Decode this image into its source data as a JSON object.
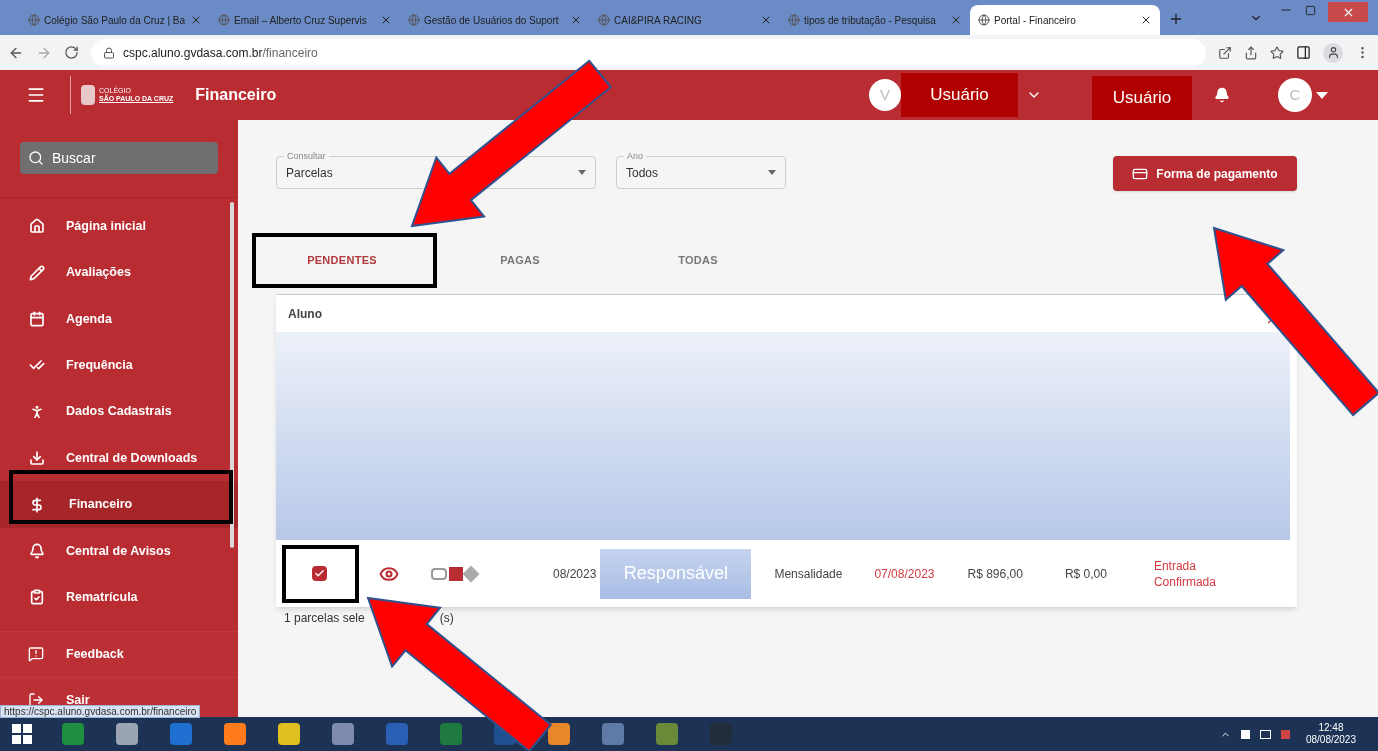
{
  "browser": {
    "tabs": [
      {
        "title": "Colégio São Paulo da Cruz | Ba",
        "selected": false
      },
      {
        "title": "Email – Alberto Cruz Supervis",
        "selected": false
      },
      {
        "title": "Gestão de Usuários do Suport",
        "selected": false
      },
      {
        "title": "CAI&PIRA RACING",
        "selected": false
      },
      {
        "title": "tipos de tributação - Pesquisa",
        "selected": false
      },
      {
        "title": "Portal - Financeiro",
        "selected": true
      }
    ],
    "url_host": "cspc.aluno.gvdasa.com.br",
    "url_path": "/financeiro"
  },
  "header": {
    "logo_small": "COLÉGIO",
    "logo_name": "SÃO PAULO DA CRUZ",
    "title": "Financeiro",
    "avatar_left": "V",
    "user_label_1": "Usuário",
    "user_label_2": "Usuário",
    "avatar_right": "C"
  },
  "sidebar": {
    "search_placeholder": "Buscar",
    "items": [
      {
        "label": "Página inicial",
        "selected": false
      },
      {
        "label": "Avaliações",
        "selected": false
      },
      {
        "label": "Agenda",
        "selected": false
      },
      {
        "label": "Frequência",
        "selected": false
      },
      {
        "label": "Dados Cadastrais",
        "selected": false
      },
      {
        "label": "Central de Downloads",
        "selected": false
      },
      {
        "label": "Financeiro",
        "selected": true
      },
      {
        "label": "Central de Avisos",
        "selected": false
      },
      {
        "label": "Rematrícula",
        "selected": false
      }
    ],
    "footer_items": [
      {
        "label": "Feedback"
      },
      {
        "label": "Sair"
      }
    ]
  },
  "filters": [
    {
      "label": "Consultar",
      "value": "Parcelas"
    },
    {
      "label": "Ano",
      "value": "Todos"
    }
  ],
  "payment_button": "Forma de pagamento",
  "tabs": [
    {
      "label": "PENDENTES",
      "selected": true
    },
    {
      "label": "PAGAS",
      "selected": false
    },
    {
      "label": "TODAS",
      "selected": false
    }
  ],
  "table": {
    "group_label": "Aluno",
    "expanded": true,
    "rows": [
      {
        "checked": true,
        "period": "08/2023",
        "responsible": "Responsável",
        "type": "Mensalidade",
        "due_date": "07/08/2023",
        "amount": "R$ 896,00",
        "discount": "R$ 0,00",
        "status": "Entrada Confirmada"
      }
    ]
  },
  "selection_note": [
    "1 parcelas sele",
    "(s)"
  ],
  "status_url": "https://cspc.aluno.gvdasa.com.br/financeiro",
  "taskbar": {
    "time": "12:48",
    "date": "08/08/2023"
  }
}
